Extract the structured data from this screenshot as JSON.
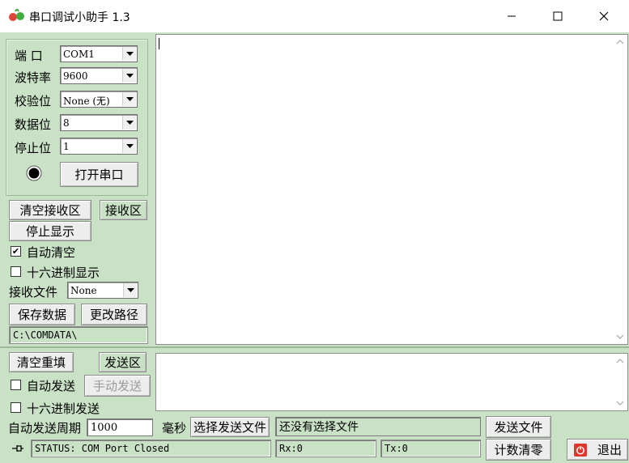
{
  "window": {
    "title": "串口调试小助手 1.3",
    "minimize_icon": "minimize-icon",
    "maximize_icon": "maximize-icon",
    "close_icon": "close-icon"
  },
  "settings": {
    "port_label": "端 口",
    "port_value": "COM1",
    "baud_label": "波特率",
    "baud_value": "9600",
    "parity_label": "校验位",
    "parity_value": "None (无)",
    "databits_label": "数据位",
    "databits_value": "8",
    "stopbits_label": "停止位",
    "stopbits_value": "1",
    "open_port_button": "打开串口"
  },
  "receive": {
    "clear_button": "清空接收区",
    "area_button": "接收区",
    "stop_display_button": "停止显示",
    "auto_clear_label": "自动清空",
    "auto_clear_checked": true,
    "hex_display_label": "十六进制显示",
    "hex_display_checked": false,
    "file_label": "接收文件",
    "file_value": "None",
    "save_button": "保存数据",
    "change_path_button": "更改路径",
    "path": "C:\\COMDATA\\"
  },
  "send": {
    "clear_button": "清空重填",
    "area_button": "发送区",
    "auto_send_label": "自动发送",
    "auto_send_checked": false,
    "manual_send_button": "手动发送",
    "hex_send_label": "十六进制发送",
    "hex_send_checked": false,
    "period_label": "自动发送周期",
    "period_value": "1000",
    "ms_label": "毫秒",
    "choose_file_button": "选择发送文件",
    "file_status": "还没有选择文件",
    "send_file_button": "发送文件"
  },
  "statusbar": {
    "status_text": "STATUS: COM Port Closed",
    "rx_text": "Rx:0",
    "tx_text": "Tx:0",
    "reset_count_button": "计数清零",
    "exit_button": "退出"
  }
}
